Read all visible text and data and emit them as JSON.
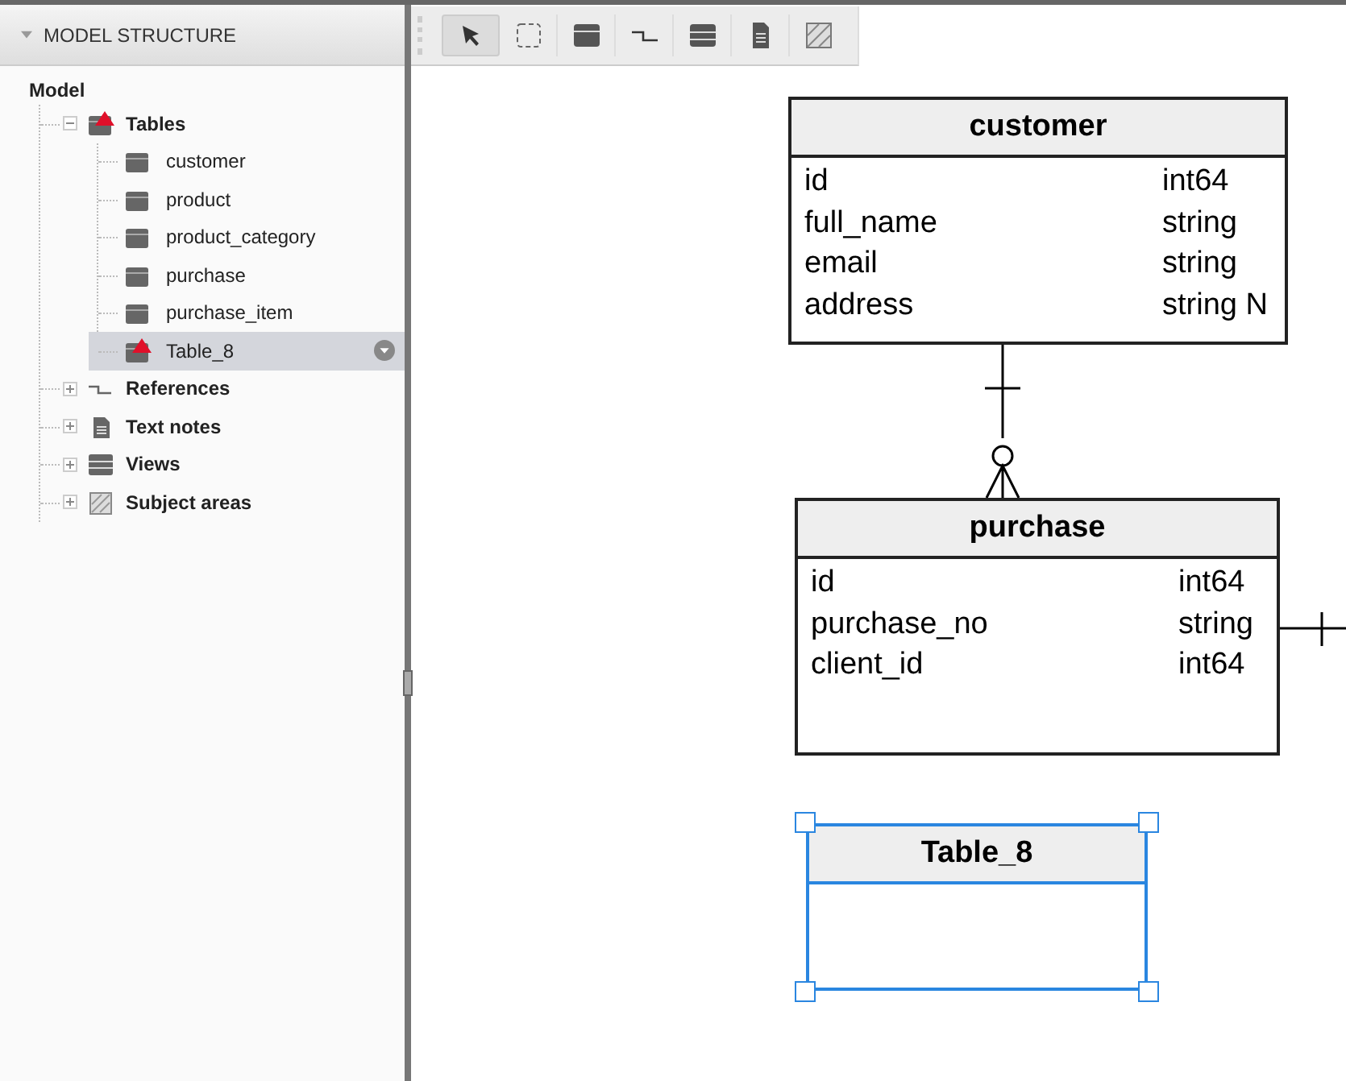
{
  "panel": {
    "title": "MODEL STRUCTURE",
    "expanded": true
  },
  "tree": {
    "label": "Model",
    "children": [
      {
        "label": "Tables",
        "kind": "table",
        "warning": true,
        "expanded": true,
        "selected": false,
        "children": [
          {
            "label": "customer",
            "kind": "table",
            "warning": false,
            "selected": false
          },
          {
            "label": "product",
            "kind": "table",
            "warning": false,
            "selected": false
          },
          {
            "label": "product_category",
            "kind": "table",
            "warning": false,
            "selected": false
          },
          {
            "label": "purchase",
            "kind": "table",
            "warning": false,
            "selected": false
          },
          {
            "label": "purchase_item",
            "kind": "table",
            "warning": false,
            "selected": false
          },
          {
            "label": "Table_8",
            "kind": "table",
            "warning": true,
            "selected": true
          }
        ]
      },
      {
        "label": "References",
        "kind": "reference",
        "warning": false,
        "expanded": false,
        "selected": false
      },
      {
        "label": "Text notes",
        "kind": "note",
        "warning": false,
        "expanded": false,
        "selected": false
      },
      {
        "label": "Views",
        "kind": "view",
        "warning": false,
        "expanded": false,
        "selected": false
      },
      {
        "label": "Subject areas",
        "kind": "area",
        "warning": false,
        "expanded": false,
        "selected": false
      }
    ]
  },
  "toolbar": [
    {
      "kind": "pointer",
      "selected": true
    },
    {
      "kind": "select",
      "selected": false
    },
    {
      "kind": "table",
      "selected": false
    },
    {
      "kind": "reference",
      "selected": false
    },
    {
      "kind": "view",
      "selected": false
    },
    {
      "kind": "note",
      "selected": false
    },
    {
      "kind": "area",
      "selected": false
    }
  ],
  "tables": [
    {
      "name": "customer",
      "selected": false,
      "columns": [
        {
          "name": "id",
          "type": "int64"
        },
        {
          "name": "full_name",
          "type": "string"
        },
        {
          "name": "email",
          "type": "string"
        },
        {
          "name": "address",
          "type": "string N"
        }
      ]
    },
    {
      "name": "purchase",
      "selected": false,
      "columns": [
        {
          "name": "id",
          "type": "int64"
        },
        {
          "name": "purchase_no",
          "type": "string"
        },
        {
          "name": "client_id",
          "type": "int64"
        }
      ]
    },
    {
      "name": "Table_8",
      "selected": true
    }
  ]
}
